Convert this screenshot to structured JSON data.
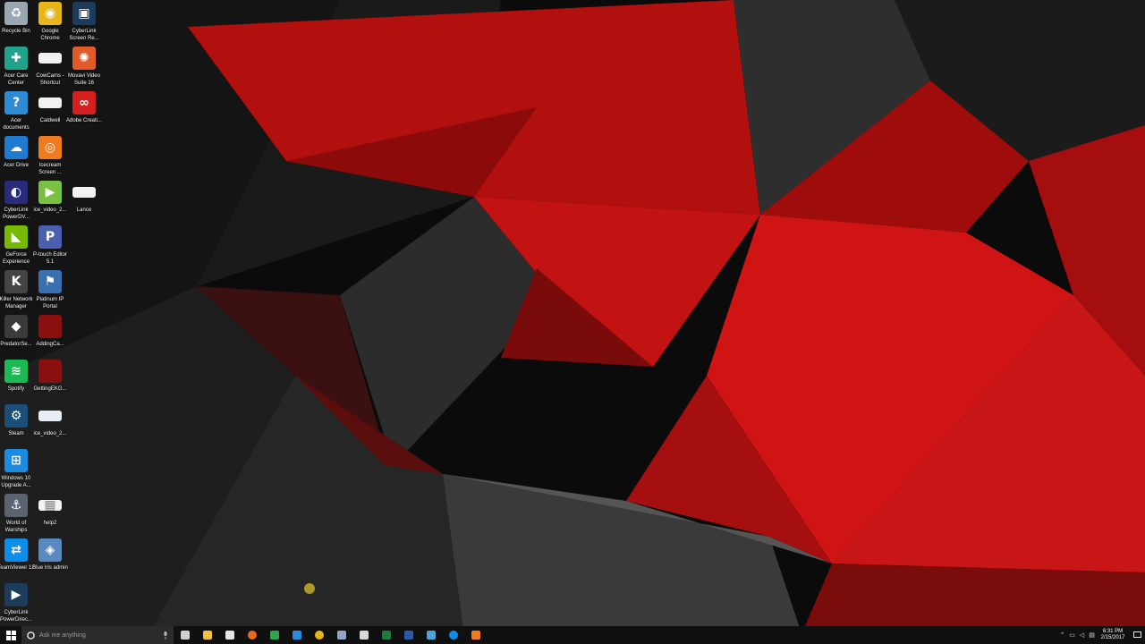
{
  "colors": {
    "accent_red": "#c10d0d",
    "taskbar": "#101010",
    "search_bg": "#2b2b2b"
  },
  "desktop_icons": [
    {
      "label": "Recycle Bin",
      "icon": "recycle-bin-icon",
      "color": "#9aa7b3"
    },
    {
      "label": "Google Chrome",
      "icon": "chrome-icon",
      "color": "#e8b61a"
    },
    {
      "label": "CyberLink Screen Re...",
      "icon": "cyberlink-screen-recorder-icon",
      "color": "#1d3b5a"
    },
    {
      "label": "Acer Care Center",
      "icon": "acer-care-center-icon",
      "color": "#20a38a"
    },
    {
      "label": "CowCams - Shortcut",
      "icon": "shortcut-file-icon",
      "color": "#f2f2f2"
    },
    {
      "label": "Movavi Video Suite 16",
      "icon": "movavi-icon",
      "color": "#e05a2a"
    },
    {
      "label": "Acer documents",
      "icon": "acer-documents-icon",
      "color": "#2d8bd6"
    },
    {
      "label": "Caldwell",
      "icon": "blank-file-icon",
      "color": "#f2f2f2"
    },
    {
      "label": "Adobe Creati...",
      "icon": "adobe-creative-cloud-icon",
      "color": "#d41f1f"
    },
    {
      "label": "Acer Drive",
      "icon": "acer-drive-icon",
      "color": "#1f7ad1"
    },
    {
      "label": "Icecream Screen ...",
      "icon": "icecream-screen-icon",
      "color": "#f07a1e"
    },
    {
      "label": "CyberLink PowerDV...",
      "icon": "cyberlink-powerdvd-icon",
      "color": "#2a2a7a"
    },
    {
      "label": "ice_video_2...",
      "icon": "video-play-icon",
      "color": "#7ac143"
    },
    {
      "label": "Lance",
      "icon": "blank-file-icon",
      "color": "#f2f2f2"
    },
    {
      "label": "GeForce Experience",
      "icon": "nvidia-icon",
      "color": "#76b900"
    },
    {
      "label": "P-touch Editor 5.1",
      "icon": "ptouch-editor-icon",
      "color": "#4b5fb0"
    },
    {
      "label": "Killer Network Manager",
      "icon": "killer-network-icon",
      "color": "#444444"
    },
    {
      "label": "Platinum IP Portal",
      "icon": "ip-portal-icon",
      "color": "#3a6fb0"
    },
    {
      "label": "PredatorSe...",
      "icon": "predator-sense-icon",
      "color": "#3a3a3a"
    },
    {
      "label": "AddingCa...",
      "icon": "video-file-icon",
      "color": "#8a1010"
    },
    {
      "label": "Spotify",
      "icon": "spotify-icon",
      "color": "#1db954"
    },
    {
      "label": "GettingEKG...",
      "icon": "video-file-icon",
      "color": "#8a1010"
    },
    {
      "label": "Steam",
      "icon": "steam-icon",
      "color": "#1b4f7a"
    },
    {
      "label": "ice_video_2...",
      "icon": "video-file-icon",
      "color": "#e9eef5"
    },
    {
      "label": "Windows 10 Upgrade A...",
      "icon": "windows-upgrade-icon",
      "color": "#1a8be0"
    },
    {
      "label": "World of Warships",
      "icon": "world-of-warships-icon",
      "color": "#5a6470"
    },
    {
      "label": "help2",
      "icon": "image-file-icon",
      "color": "#f2f2f2"
    },
    {
      "label": "TeamViewer 12",
      "icon": "teamviewer-icon",
      "color": "#0e8ee9"
    },
    {
      "label": "Blue Iris admin",
      "icon": "blue-iris-icon",
      "color": "#5a88c0"
    },
    {
      "label": "CyberLink PowerDirec...",
      "icon": "cyberlink-powerdirector-icon",
      "color": "#1d3b5a"
    }
  ],
  "taskbar": {
    "search_placeholder": "Ask me anything",
    "apps": [
      {
        "icon": "task-view-icon",
        "color": "#cfcfcf"
      },
      {
        "icon": "file-explorer-icon",
        "color": "#f3c13a"
      },
      {
        "icon": "store-icon",
        "color": "#e6e6e6"
      },
      {
        "icon": "firefox-icon",
        "color": "#e66a22"
      },
      {
        "icon": "sheets-icon",
        "color": "#2fa44f"
      },
      {
        "icon": "edge-icon",
        "color": "#2a8be0"
      },
      {
        "icon": "chrome-icon",
        "color": "#e8b61a"
      },
      {
        "icon": "app-grid-icon",
        "color": "#8fa5c5"
      },
      {
        "icon": "calculator-icon",
        "color": "#d8d8d8"
      },
      {
        "icon": "excel-icon",
        "color": "#1f7a3e"
      },
      {
        "icon": "word-icon",
        "color": "#2b5aa8"
      },
      {
        "icon": "remote-desktop-icon",
        "color": "#4fa3d8"
      },
      {
        "icon": "teamviewer-icon",
        "color": "#0e8ee9"
      },
      {
        "icon": "icecream-screen-icon",
        "color": "#f07a1e"
      }
    ],
    "tray": {
      "icons": [
        "chevron-up-icon",
        "network-icon",
        "volume-icon",
        "keyboard-icon"
      ],
      "time": "6:31 PM",
      "date": "2/15/2017"
    }
  }
}
